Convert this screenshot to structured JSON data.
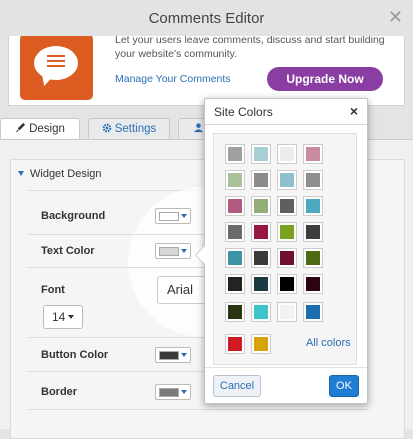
{
  "window": {
    "title": "Comments Editor",
    "close_glyph": "✕"
  },
  "hero": {
    "description": "Let your users leave comments, discuss and start building your website's community.",
    "manage_link": "Manage Your Comments",
    "upgrade_label": "Upgrade Now"
  },
  "tabs": [
    {
      "label": "Design",
      "icon": "brush-icon",
      "active": true
    },
    {
      "label": "Settings",
      "icon": "gear-icon",
      "active": false
    },
    {
      "label": "",
      "icon": "user-icon",
      "active": false
    }
  ],
  "design": {
    "section_title": "Widget Design",
    "background": {
      "label": "Background",
      "color": "#ffffff"
    },
    "text_color": {
      "label": "Text Color",
      "color": "#d6d6d6"
    },
    "font": {
      "label": "Font",
      "value": "Arial",
      "size": "14"
    },
    "button_color": {
      "label": "Button Color",
      "color": "#3a3a3a"
    },
    "border": {
      "label": "Border",
      "color": "#7a7a7a"
    }
  },
  "site_colors": {
    "title": "Site Colors",
    "close_glyph": "×",
    "palette": [
      [
        "#a0a0a0",
        "#a9cfd6",
        "#ececec",
        "#c88ba1"
      ],
      [
        "#a9c29a",
        "#8c8c8c",
        "#8fbfcc",
        "#8e8e8e"
      ],
      [
        "#b25a80",
        "#94ad78",
        "#5f5f5f",
        "#4caac0"
      ],
      [
        "#6b6b6b",
        "#9b1544",
        "#78a21f",
        "#3d3d3d"
      ],
      [
        "#3e93a4",
        "#3a3a3a",
        "#700f30",
        "#4e6a13"
      ],
      [
        "#232323",
        "#1c3a40",
        "#000000",
        "#2b0312"
      ]
    ],
    "extra_colors": [
      "#2a3410",
      "#3fc4cc",
      "#f2f2f2",
      "#1b6fb0"
    ],
    "custom_colors": [
      "#d01a24",
      "#d6a407"
    ],
    "all_colors_label": "All colors",
    "cancel_label": "Cancel",
    "ok_label": "OK"
  }
}
